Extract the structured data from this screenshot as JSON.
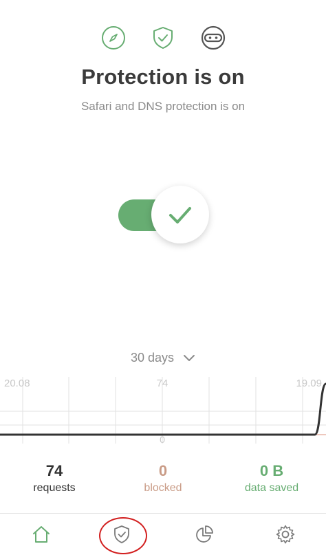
{
  "colors": {
    "accent": "#67ad72",
    "blocked": "#c99b86",
    "saved": "#67ad72",
    "annotation": "#d21f1f"
  },
  "top_icons": [
    "compass-icon",
    "shield-check-icon",
    "ninja-mask-icon"
  ],
  "header": {
    "title": "Protection is on",
    "subtitle": "Safari and DNS protection is on"
  },
  "toggle": {
    "state": "on"
  },
  "period": {
    "label": "30 days"
  },
  "chart_data": {
    "type": "line",
    "x_labels": [
      "20.08",
      "19.09"
    ],
    "y_max_label": "74",
    "y_min_label": "0",
    "series": [
      {
        "values": [
          0,
          0,
          0,
          0,
          0,
          0,
          0,
          0,
          0,
          0,
          0,
          0,
          0,
          0,
          0,
          0,
          0,
          0,
          0,
          0,
          0,
          0,
          0,
          0,
          0,
          0,
          0,
          0,
          0,
          74
        ]
      }
    ],
    "ylim": [
      0,
      74
    ]
  },
  "stats": {
    "requests": {
      "value": "74",
      "label": "requests"
    },
    "blocked": {
      "value": "0",
      "label": "blocked"
    },
    "saved": {
      "value": "0 B",
      "label": "data saved"
    }
  },
  "nav": [
    "home-icon",
    "shield-check-icon",
    "pie-chart-icon",
    "gear-icon"
  ]
}
